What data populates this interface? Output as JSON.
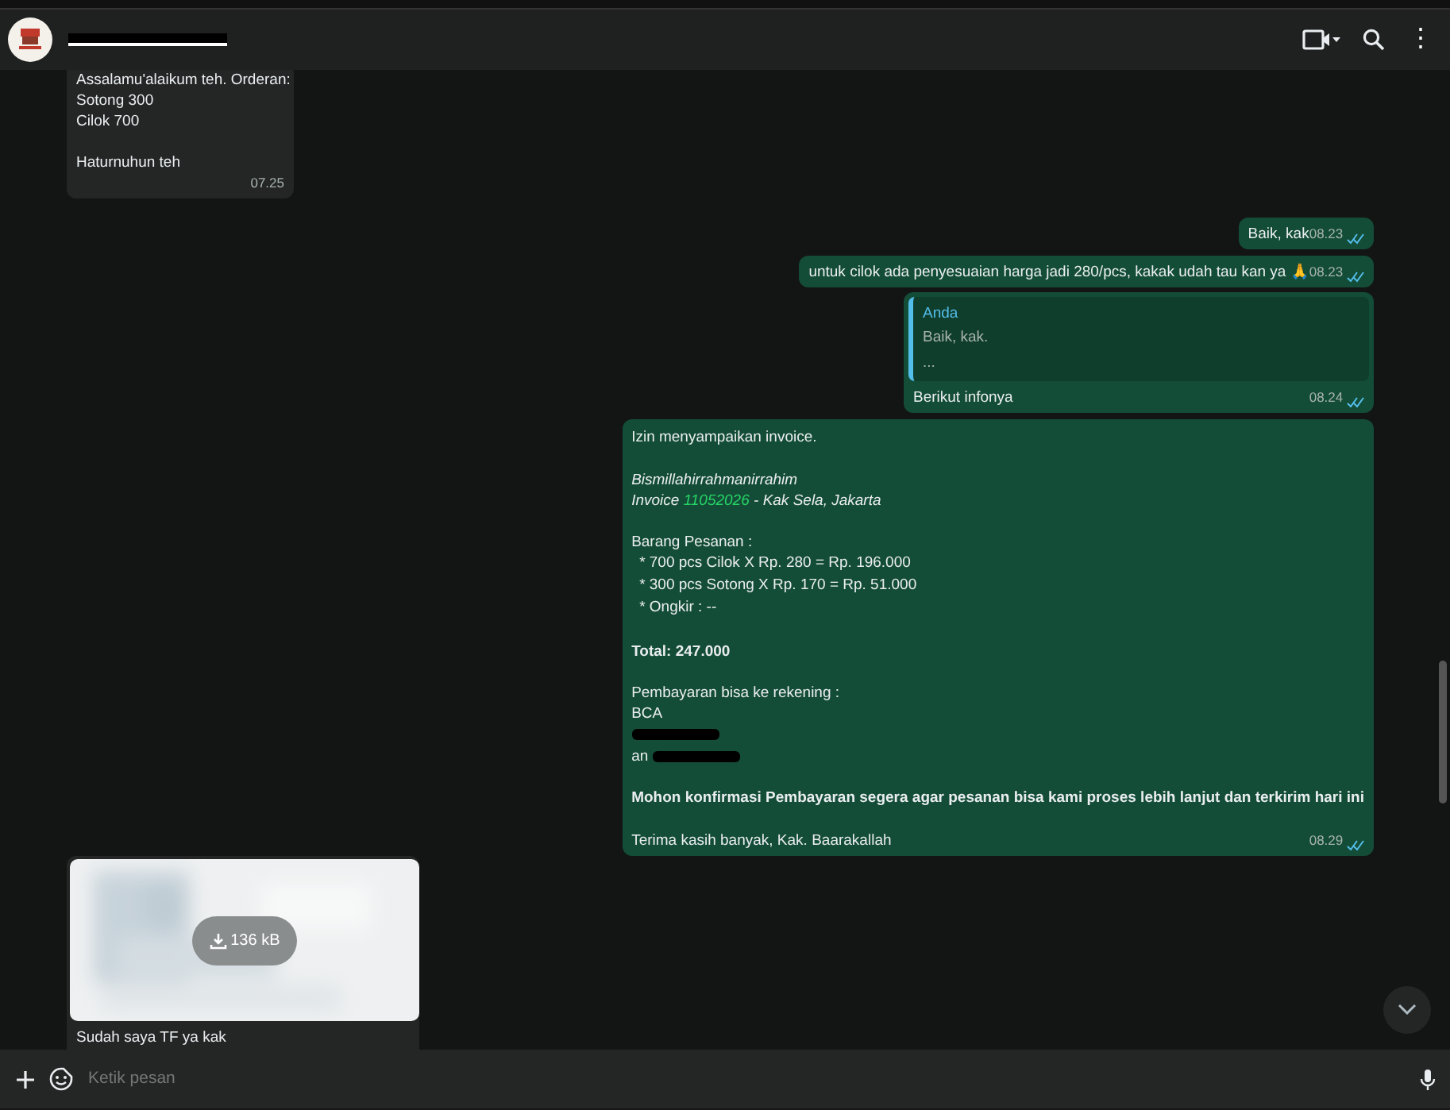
{
  "header": {
    "title_redacted": true,
    "menu": "⋮"
  },
  "messages": [
    {
      "kind": "text",
      "outgoing": false,
      "paragraphs": [
        [
          "Assalamu'alaikum teh. Orderan:",
          "Sotong 300",
          "Cilok 700"
        ],
        [
          "Haturnuhun teh"
        ]
      ],
      "time": "07.25"
    },
    {
      "kind": "text",
      "outgoing": true,
      "paragraphs": [
        [
          "Baik, kak"
        ]
      ],
      "time": "08.23",
      "read": true
    },
    {
      "kind": "text",
      "outgoing": true,
      "paragraphs": [
        [
          "untuk cilok ada penyesuaian harga jadi 280/pcs, kakak udah tau kan ya 🙏"
        ]
      ],
      "time": "08.23",
      "read": true
    },
    {
      "kind": "quote",
      "outgoing": true,
      "quote_author": "Anda",
      "quote_lines": [
        "Baik, kak.",
        "..."
      ],
      "lines": [
        "Berikut infonya"
      ],
      "time": "08.24",
      "read": true
    },
    {
      "kind": "invoice",
      "outgoing": true,
      "time": "08.29",
      "read": true,
      "rows": [
        {
          "kind": "plain",
          "text": "Izin menyampaikan invoice."
        },
        {
          "kind": "blank"
        },
        {
          "kind": "italic",
          "text": "Bismillahirrahmanirrahim"
        },
        {
          "kind": "ref",
          "prefix": "Invoice ",
          "number": "11052026",
          "suffix": " - Kak Sela, Jakarta"
        },
        {
          "kind": "blank"
        },
        {
          "kind": "plain",
          "text": "Barang Pesanan :"
        },
        {
          "kind": "bullet",
          "text": "* 700 pcs Cilok X Rp. 280 = Rp. 196.000"
        },
        {
          "kind": "bullet",
          "text": "* 300 pcs Sotong X Rp. 170 = Rp. 51.000"
        },
        {
          "kind": "bullet",
          "text": "* Ongkir : --"
        },
        {
          "kind": "blank"
        },
        {
          "kind": "bold",
          "text": "Total: 247.000"
        },
        {
          "kind": "blank"
        },
        {
          "kind": "plain",
          "text": "Pembayaran bisa ke rekening :"
        },
        {
          "kind": "plain",
          "text": "BCA"
        },
        {
          "kind": "redacted"
        },
        {
          "kind": "plain",
          "text": "an",
          "redacted": true
        },
        {
          "kind": "blank"
        },
        {
          "kind": "bold",
          "text": "Mohon konfirmasi Pembayaran segera agar pesanan bisa kami proses lebih lanjut dan terkirim hari ini"
        },
        {
          "kind": "blank"
        },
        {
          "kind": "plain",
          "text": "Terima kasih banyak, Kak. Baarakallah"
        }
      ]
    },
    {
      "outgoing": false,
      "size": "136 kB",
      "caption": "Sudah saya TF ya kak"
    }
  ],
  "composer": {
    "placeholder": "Ketik pesan"
  }
}
